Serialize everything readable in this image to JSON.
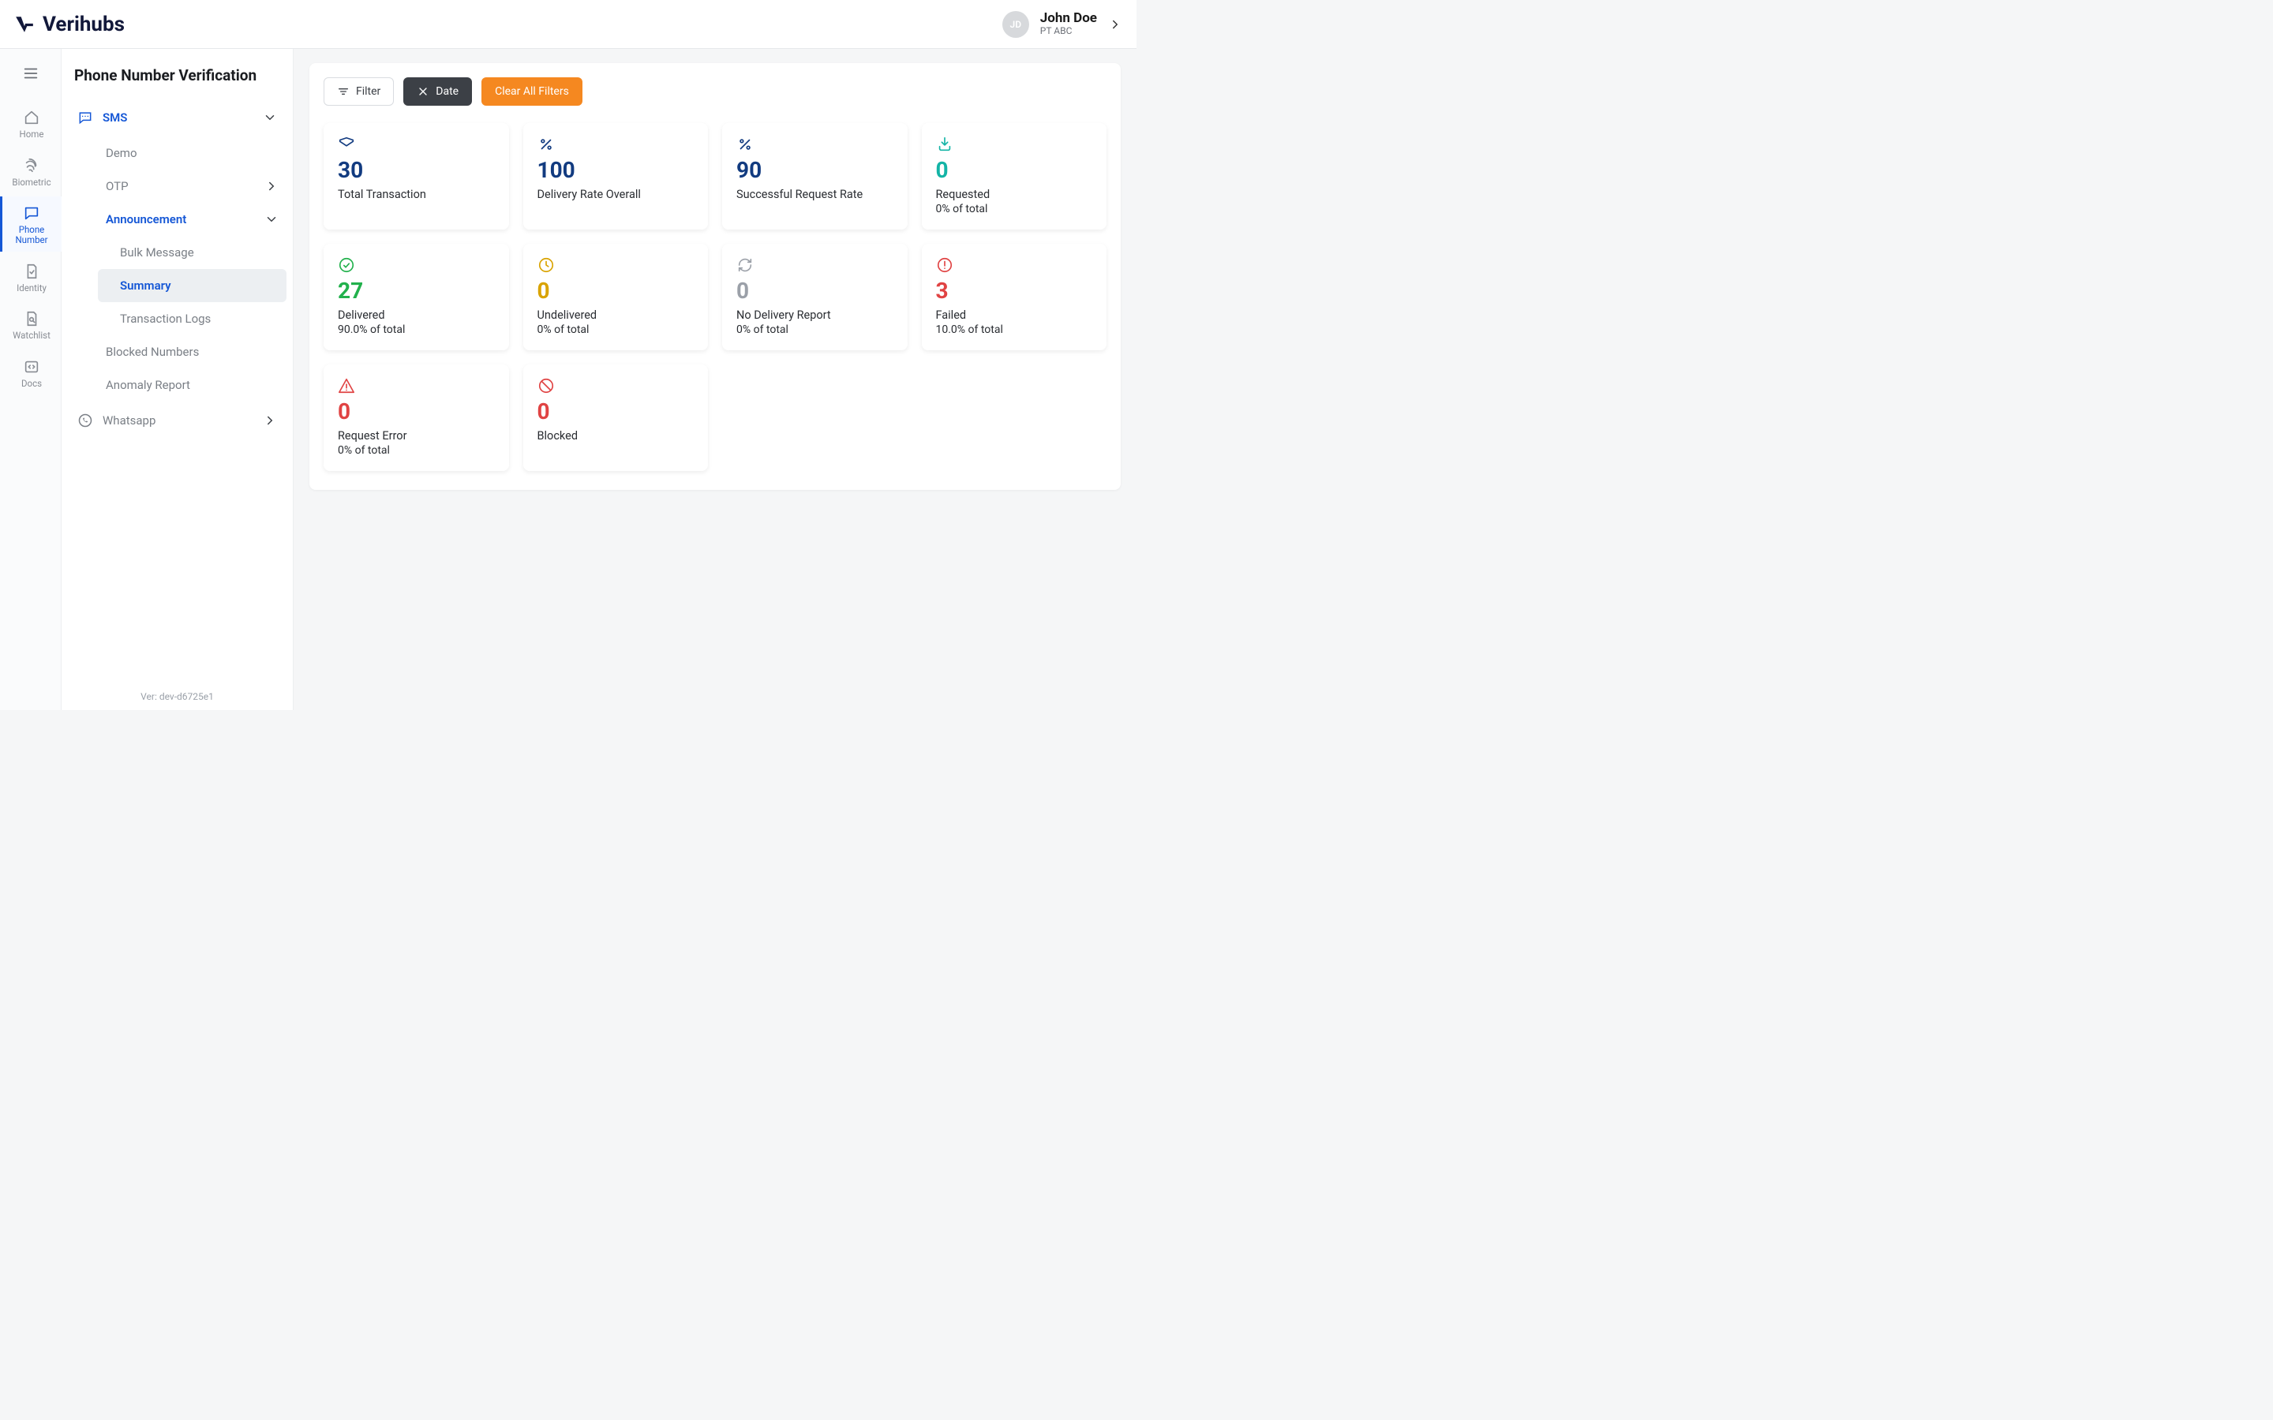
{
  "brand": "Verihubs",
  "user": {
    "initials": "JD",
    "name": "John Doe",
    "org": "PT ABC"
  },
  "rail": {
    "items": [
      {
        "id": "home",
        "label": "Home"
      },
      {
        "id": "biometric",
        "label": "Biometric"
      },
      {
        "id": "phone",
        "label": "Phone Number",
        "active": true
      },
      {
        "id": "identity",
        "label": "Identity"
      },
      {
        "id": "watchlist",
        "label": "Watchlist"
      },
      {
        "id": "docs",
        "label": "Docs"
      }
    ]
  },
  "sidepanel": {
    "title": "Phone Number Verification",
    "sms": "SMS",
    "demo": "Demo",
    "otp": "OTP",
    "announcement": "Announcement",
    "bulk": "Bulk Message",
    "summary": "Summary",
    "tlogs": "Transaction Logs",
    "blocked": "Blocked Numbers",
    "anomaly": "Anomaly Report",
    "whatsapp": "Whatsapp",
    "version": "Ver: dev-d6725e1"
  },
  "toolbar": {
    "filter": "Filter",
    "date": "Date",
    "clear": "Clear All Filters"
  },
  "metrics": [
    {
      "id": "total",
      "value": "30",
      "label": "Total Transaction",
      "sub": "",
      "icon": "envelope",
      "color": "c-blue"
    },
    {
      "id": "delivrate",
      "value": "100",
      "label": "Delivery Rate Overall",
      "sub": "",
      "icon": "percent",
      "color": "c-blue"
    },
    {
      "id": "succrate",
      "value": "90",
      "label": "Successful Request Rate",
      "sub": "",
      "icon": "percent",
      "color": "c-blue"
    },
    {
      "id": "requested",
      "value": "0",
      "label": "Requested",
      "sub": "0% of total",
      "icon": "download",
      "color": "c-teal"
    },
    {
      "id": "delivered",
      "value": "27",
      "label": "Delivered",
      "sub": "90.0% of total",
      "icon": "check",
      "color": "c-green"
    },
    {
      "id": "undelivered",
      "value": "0",
      "label": "Undelivered",
      "sub": "0% of total",
      "icon": "clock",
      "color": "c-amber"
    },
    {
      "id": "noreport",
      "value": "0",
      "label": "No Delivery Report",
      "sub": "0% of total",
      "icon": "refresh",
      "color": "c-gray"
    },
    {
      "id": "failed",
      "value": "3",
      "label": "Failed",
      "sub": "10.0% of total",
      "icon": "alert",
      "color": "c-red"
    },
    {
      "id": "reqerror",
      "value": "0",
      "label": "Request Error",
      "sub": "0% of total",
      "icon": "warn",
      "color": "c-red"
    },
    {
      "id": "blocked",
      "value": "0",
      "label": "Blocked",
      "sub": "",
      "icon": "ban",
      "color": "c-red"
    }
  ]
}
